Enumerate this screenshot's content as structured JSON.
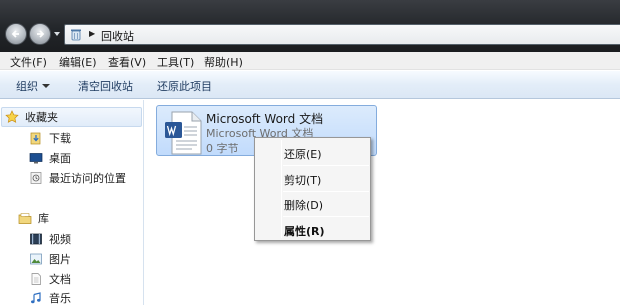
{
  "address": {
    "location": "回收站"
  },
  "menu": {
    "file": "文件(F)",
    "edit": "编辑(E)",
    "view": "查看(V)",
    "tools": "工具(T)",
    "help": "帮助(H)"
  },
  "commands": {
    "organize": "组织",
    "empty_bin": "清空回收站",
    "restore_all": "还原此项目"
  },
  "nav": {
    "favorites": {
      "label": "收藏夹",
      "items": [
        "下载",
        "桌面",
        "最近访问的位置"
      ]
    },
    "libraries": {
      "label": "库",
      "items": [
        "视频",
        "图片",
        "文档",
        "音乐"
      ]
    }
  },
  "file": {
    "name": "Microsoft Word 文档",
    "type": "Microsoft Word 文档",
    "size": "0 字节"
  },
  "context_menu": {
    "restore": "还原(E)",
    "cut": "剪切(T)",
    "delete": "删除(D)",
    "properties": "属性(R)"
  },
  "colors": {
    "selection": "#c1dbfc",
    "selection_border": "#84acdd",
    "command_bar": "#dbe7f5",
    "title_bar": "#23262a"
  }
}
